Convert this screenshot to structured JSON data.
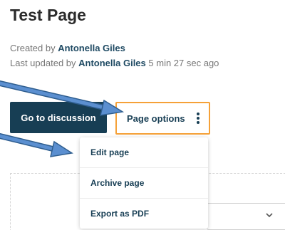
{
  "page": {
    "title": "Test Page"
  },
  "meta": {
    "created_prefix": "Created by ",
    "created_author": "Antonella Giles",
    "updated_prefix": "Last updated by ",
    "updated_author": "Antonella Giles",
    "updated_time": " 5 min 27 sec ago"
  },
  "actions": {
    "discussion_label": "Go to discussion",
    "options_label": "Page options"
  },
  "menu": {
    "items": [
      {
        "label": "Edit page"
      },
      {
        "label": "Archive page"
      },
      {
        "label": "Export as PDF"
      }
    ]
  },
  "icons": {
    "options_menu": "kebab-vertical-icon",
    "select_caret": "chevron-down-icon",
    "annotation": "arrow-icon"
  },
  "colors": {
    "primary": "#173e54",
    "author_link": "#1f4a63",
    "focus_outline": "#f5a138",
    "annotation_arrow": "#5b8fd0",
    "muted_text": "#767676"
  }
}
